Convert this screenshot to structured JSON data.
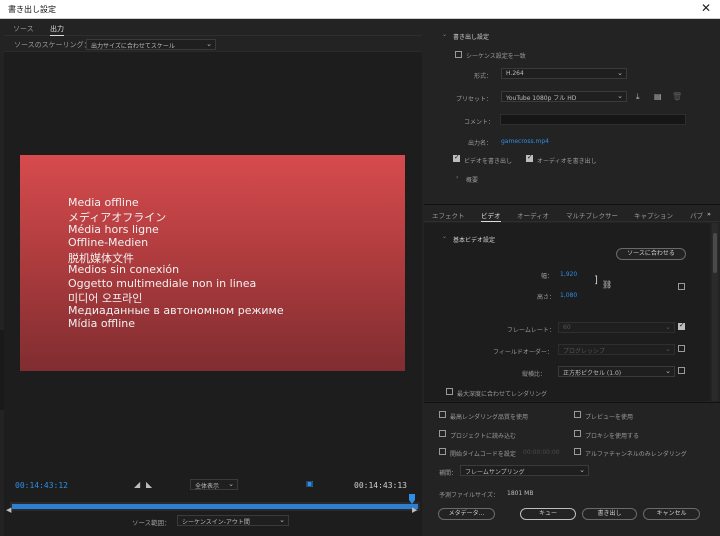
{
  "window": {
    "title": "書き出し設定",
    "close": "✕"
  },
  "left": {
    "tabs": [
      {
        "label": "ソース"
      },
      {
        "label": "出力"
      }
    ],
    "scaling_label": "ソースのスケーリング：",
    "scaling_value": "出力サイズに合わせてスケール",
    "preview_lines": [
      "Media offline",
      "メディアオフライン",
      "Média hors ligne",
      "Offline-Medien",
      "脱机媒体文件",
      "Medios sin conexión",
      "Oggetto multimediale non in linea",
      "미디어 오프라인",
      "Медиаданные в автономном режиме",
      "Mídia offline"
    ],
    "timecode_in": "00:14:43:12",
    "timecode_out": "00:14:43:13",
    "zoom_value": "全体表示",
    "source_range_label": "ソース範囲：",
    "source_range_value": "シーケンスイン-アウト間"
  },
  "export": {
    "section_title": "書き出し設定",
    "match_sequence": "シーケンス設定を一致",
    "format_label": "形式：",
    "format_value": "H.264",
    "preset_label": "プリセット：",
    "preset_value": "YouTube  1080p フル HD",
    "comment_label": "コメント：",
    "output_name_label": "出力名：",
    "output_name_value": "gamecross.mp4",
    "export_video": "ビデオを書き出し",
    "export_audio": "オーディオを書き出し",
    "summary": "概要"
  },
  "tabs2": [
    "エフェクト",
    "ビデオ",
    "オーディオ",
    "マルチプレクサー",
    "キャプション",
    "パブ"
  ],
  "video": {
    "section_title": "基本ビデオ設定",
    "match_source": "ソースに合わせる",
    "width_label": "幅：",
    "width_value": "1,920",
    "height_label": "高さ：",
    "height_value": "1,080",
    "framerate_label": "フレームレート：",
    "framerate_value": "60",
    "field_order_label": "フィールドオーダー：",
    "field_order_value": "プログレッシブ",
    "aspect_label": "縦横比：",
    "aspect_value": "正方形ピクセル (1.0)",
    "max_depth": "最大深度に合わせてレンダリング"
  },
  "bottom": {
    "max_render_quality": "最高レンダリング品質を使用",
    "use_previews": "プレビューを使用",
    "import_project": "プロジェクトに読み込む",
    "use_proxies": "プロキシを使用する",
    "set_start_tc": "開始タイムコードを設定",
    "start_tc_value": "00:00:00:00",
    "alpha_only": "アルファチャンネルのみレンダリング",
    "interp_label": "補間：",
    "interp_value": "フレームサンプリング",
    "filesize_label": "予測ファイルサイズ：",
    "filesize_value": "1801 MB",
    "metadata_button": "メタデータ...",
    "queue_button": "キュー",
    "export_button": "書き出し",
    "cancel_button": "キャンセル"
  },
  "colors": {
    "accent": "#2e8ee8",
    "preview_top": "#d74b4d",
    "preview_bottom": "#802d31"
  }
}
